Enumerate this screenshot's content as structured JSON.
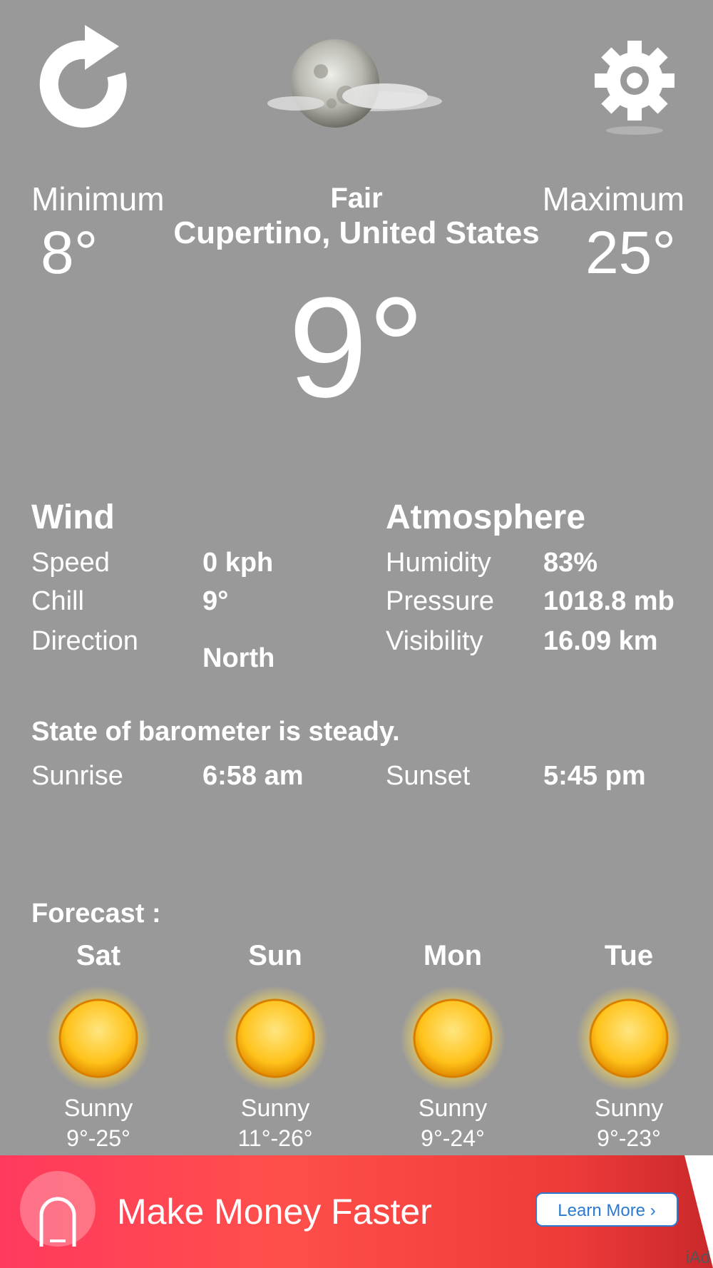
{
  "header": {
    "refresh_icon": "refresh-icon",
    "condition_icon": "moon-cloud-icon",
    "settings_icon": "gear-icon"
  },
  "current": {
    "min_label": "Minimum",
    "min_value": "8°",
    "max_label": "Maximum",
    "max_value": "25°",
    "condition": "Fair",
    "location": "Cupertino, United States",
    "temperature": "9°"
  },
  "wind": {
    "title": "Wind",
    "speed_label": "Speed",
    "speed_value": "0 kph",
    "chill_label": "Chill",
    "chill_value": "9°",
    "direction_label": "Direction",
    "direction_value": "North"
  },
  "atmosphere": {
    "title": "Atmosphere",
    "humidity_label": "Humidity",
    "humidity_value": "83%",
    "pressure_label": "Pressure",
    "pressure_value": "1018.8 mb",
    "visibility_label": "Visibility",
    "visibility_value": "16.09 km"
  },
  "barometer": "State of barometer is steady.",
  "sun": {
    "sunrise_label": "Sunrise",
    "sunrise_value": "6:58 am",
    "sunset_label": "Sunset",
    "sunset_value": "5:45 pm"
  },
  "forecast": {
    "title": "Forecast :",
    "days": [
      {
        "day": "Sat",
        "condition": "Sunny",
        "range": "9°-25°",
        "icon": "sun-icon"
      },
      {
        "day": "Sun",
        "condition": "Sunny",
        "range": "11°-26°",
        "icon": "sun-icon"
      },
      {
        "day": "Mon",
        "condition": "Sunny",
        "range": "9°-24°",
        "icon": "sun-icon"
      },
      {
        "day": "Tue",
        "condition": "Sunny",
        "range": "9°-23°",
        "icon": "sun-icon"
      }
    ]
  },
  "ad": {
    "headline": "Make Money Faster",
    "button": "Learn More ›",
    "mark": "iAd"
  },
  "colors": {
    "background": "#999999",
    "text": "#ffffff",
    "ad_button": "#2a7bd1",
    "sun": "#ffcc22"
  }
}
